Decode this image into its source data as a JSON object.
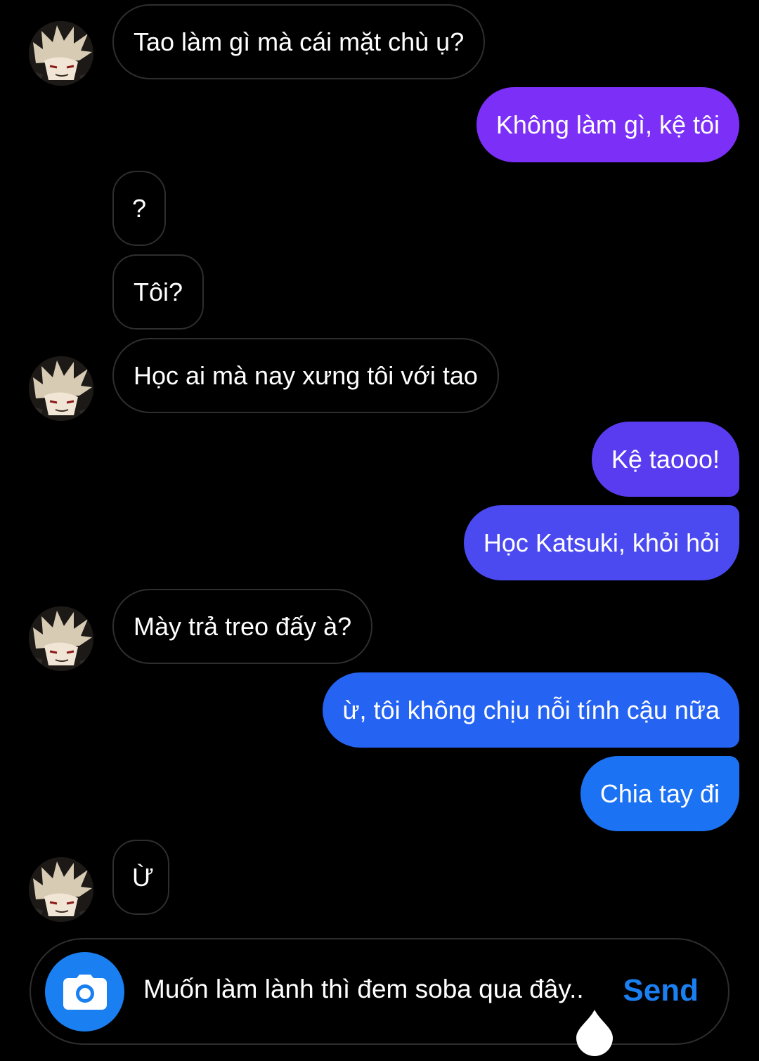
{
  "colors": {
    "background": "#000000",
    "received_border": "#2e2e2e",
    "sent_gradient_top": "#7b2ff7",
    "sent_gradient_bottom": "#1877f2",
    "accent": "#1a7ff0"
  },
  "messages": [
    {
      "side": "received",
      "text": "Tao làm gì mà cái mặt chù ụ?"
    },
    {
      "side": "sent",
      "text": "Không làm gì, kệ tôi"
    },
    {
      "side": "received",
      "text": "?"
    },
    {
      "side": "received",
      "text": "Tôi?"
    },
    {
      "side": "received",
      "text": "Học ai mà nay xưng tôi với tao"
    },
    {
      "side": "sent",
      "text": "Kệ taooo!"
    },
    {
      "side": "sent",
      "text": "Học Katsuki, khỏi hỏi"
    },
    {
      "side": "received",
      "text": "Mày trả treo đấy à?"
    },
    {
      "side": "sent",
      "text": "ừ, tôi không chịu nỗi tính cậu nữa"
    },
    {
      "side": "sent",
      "text": "Chia tay đi"
    },
    {
      "side": "received",
      "text": "Ừ"
    }
  ],
  "composer": {
    "camera_icon": "camera-icon",
    "text": "Muốn làm lành thì đem soba qua đây..",
    "send_label": "Send",
    "cursor_icon": "text-cursor-handle-icon"
  }
}
